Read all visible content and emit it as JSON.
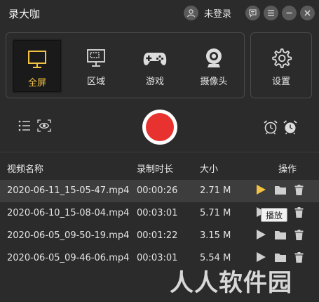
{
  "app": {
    "title": "录大咖"
  },
  "account": {
    "login_label": "未登录"
  },
  "modes": [
    {
      "label": "全屏",
      "icon": "monitor-icon",
      "active": true
    },
    {
      "label": "区域",
      "icon": "region-icon",
      "active": false
    },
    {
      "label": "游戏",
      "icon": "gamepad-icon",
      "active": false
    },
    {
      "label": "摄像头",
      "icon": "webcam-icon",
      "active": false
    }
  ],
  "settings": {
    "label": "设置",
    "icon": "gear-icon"
  },
  "table": {
    "headers": {
      "name": "视频名称",
      "duration": "录制时长",
      "size": "大小",
      "actions": "操作"
    },
    "rows": [
      {
        "name": "2020-06-11_15-05-47.mp4",
        "duration": "00:00:26",
        "size": "2.71 M"
      },
      {
        "name": "2020-06-10_15-08-04.mp4",
        "duration": "00:03:01",
        "size": "5.71 M"
      },
      {
        "name": "2020-06-05_09-50-19.mp4",
        "duration": "00:01:22",
        "size": "3.15 M"
      },
      {
        "name": "2020-06-05_09-46-06.mp4",
        "duration": "00:03:01",
        "size": "5.54 M"
      }
    ]
  },
  "tooltip": {
    "text": "播放"
  },
  "watermark": {
    "text": "人人软件园"
  },
  "colors": {
    "accent": "#f4c243",
    "record": "#e8322f",
    "background": "#2b2b2b"
  }
}
